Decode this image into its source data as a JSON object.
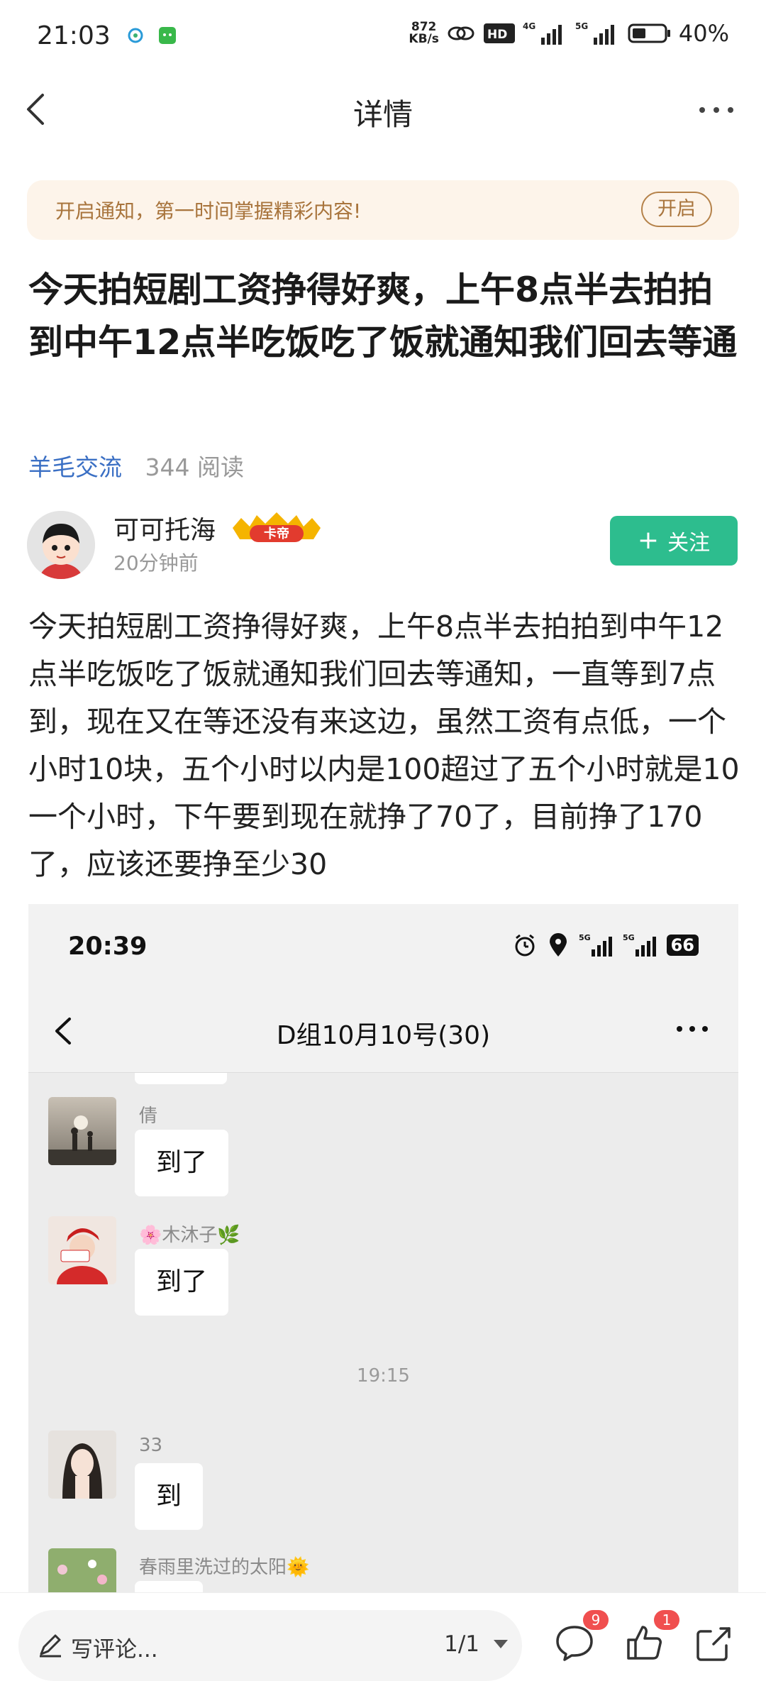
{
  "status_bar": {
    "time": "21:03",
    "net_speed_value": "872",
    "net_speed_unit": "KB/s",
    "battery": "40%"
  },
  "nav": {
    "title": "详情"
  },
  "banner": {
    "text": "开启通知，第一时间掌握精彩内容!",
    "button": "开启"
  },
  "post": {
    "title": "今天拍短剧工资挣得好爽，上午8点半去拍拍到中午12点半吃饭吃了饭就通知我们回去等通",
    "tag": "羊毛交流",
    "reads": "344 阅读",
    "author": {
      "name": "可可托海",
      "badge": "卡帝",
      "time": "20分钟前"
    },
    "follow_label": "关注",
    "body": "今天拍短剧工资挣得好爽，上午8点半去拍拍到中午12点半吃饭吃了饭就通知我们回去等通知，一直等到7点到，现在又在等还没有来这边，虽然工资有点低，一个小时10块，五个小时以内是100超过了五个小时就是10一个小时，下午要到现在就挣了70了，目前挣了170了，应该还要挣至少30"
  },
  "screenshot": {
    "time": "20:39",
    "battery": "66",
    "title": "D组10月10号(30)",
    "timestamp": "19:15",
    "messages": [
      {
        "name": "倩",
        "text": "到了"
      },
      {
        "name": "🌸木沐子🌿",
        "text": "到了"
      },
      {
        "name": "33",
        "text": "到"
      },
      {
        "name": "春雨里洗过的太阳🌞",
        "text": ""
      }
    ]
  },
  "bottom_bar": {
    "comment_placeholder": "写评论...",
    "page_indicator": "1/1",
    "comment_count": "9",
    "like_count": "1"
  },
  "colors": {
    "accent_green": "#2dbd8e",
    "banner_bg": "#fdf4ea",
    "banner_text": "#a8743c",
    "tag_blue": "#3a6fc4",
    "badge_red": "#f04f4f"
  }
}
